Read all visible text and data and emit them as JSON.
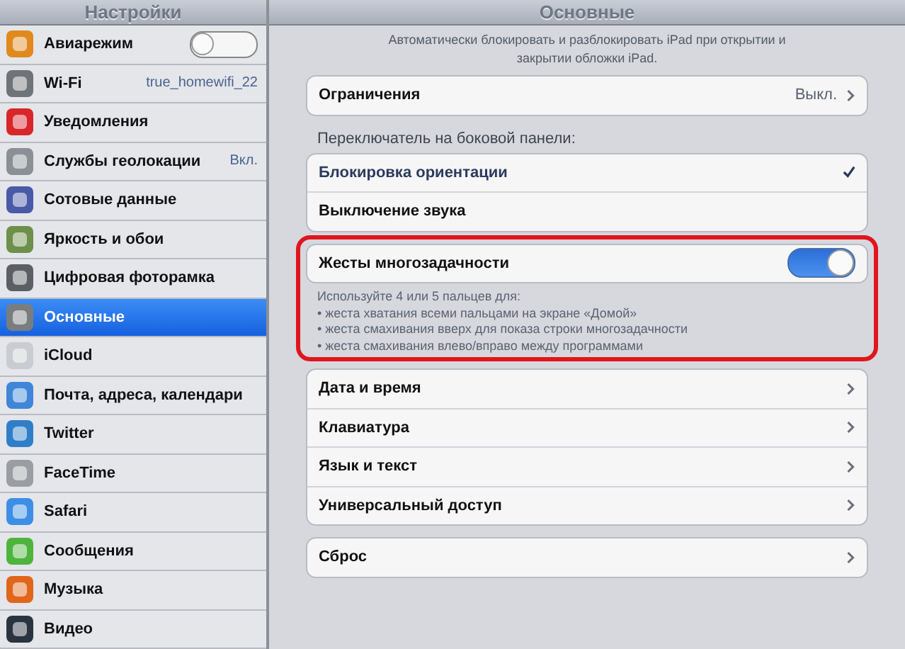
{
  "sidebar": {
    "title": "Настройки",
    "items": [
      {
        "label": "Авиарежим",
        "kind": "toggle",
        "on": false,
        "selected": false,
        "color": "#e08a1e"
      },
      {
        "label": "Wi-Fi",
        "kind": "value",
        "value": "true_homewifi_22",
        "selected": false,
        "color": "#6f7478"
      },
      {
        "label": "Уведомления",
        "kind": "plain",
        "selected": false,
        "color": "#d8262a"
      },
      {
        "label": "Службы геолокации",
        "kind": "value",
        "value": "Вкл.",
        "selected": false,
        "color": "#8a9096"
      },
      {
        "label": "Сотовые данные",
        "kind": "plain",
        "selected": false,
        "color": "#4a5aa8"
      },
      {
        "label": "Яркость и обои",
        "kind": "plain",
        "selected": false,
        "color": "#6d8f4a"
      },
      {
        "label": "Цифровая фоторамка",
        "kind": "plain",
        "selected": false,
        "color": "#5c5f63"
      },
      {
        "label": "Основные",
        "kind": "plain",
        "selected": true,
        "color": "#7a7d80"
      },
      {
        "label": "iCloud",
        "kind": "plain",
        "selected": false,
        "color": "#c9ccd0"
      },
      {
        "label": "Почта, адреса, календари",
        "kind": "plain",
        "selected": false,
        "color": "#3f86d8"
      },
      {
        "label": "Twitter",
        "kind": "plain",
        "selected": false,
        "color": "#2f7fc8"
      },
      {
        "label": "FaceTime",
        "kind": "plain",
        "selected": false,
        "color": "#9a9da2"
      },
      {
        "label": "Safari",
        "kind": "plain",
        "selected": false,
        "color": "#3d8ee6"
      },
      {
        "label": "Сообщения",
        "kind": "plain",
        "selected": false,
        "color": "#4fb43c"
      },
      {
        "label": "Музыка",
        "kind": "plain",
        "selected": false,
        "color": "#e0661c"
      },
      {
        "label": "Видео",
        "kind": "plain",
        "selected": false,
        "color": "#2a3440"
      }
    ]
  },
  "detail": {
    "title": "Основные",
    "description": "Автоматически блокировать и разблокировать iPad при открытии и закрытии обложки iPad.",
    "sections": [
      {
        "rows": [
          {
            "label": "Ограничения",
            "kind": "disclosure",
            "value": "Выкл."
          }
        ]
      },
      {
        "header": "Переключатель на боковой панели:",
        "rows": [
          {
            "label": "Блокировка ориентации",
            "kind": "check",
            "checked": true
          },
          {
            "label": "Выключение звука",
            "kind": "check",
            "checked": false
          }
        ]
      },
      {
        "highlighted": true,
        "rows": [
          {
            "label": "Жесты многозадачности",
            "kind": "toggle",
            "on": true
          }
        ],
        "footer": [
          "Используйте 4 или 5 пальцев для:",
          "• жеста хватания всеми пальцами на экране «Домой»",
          "• жеста смахивания вверх для показа строки многозадачности",
          "• жеста смахивания влево/вправо между программами"
        ]
      },
      {
        "rows": [
          {
            "label": "Дата и время",
            "kind": "disclosure"
          },
          {
            "label": "Клавиатура",
            "kind": "disclosure"
          },
          {
            "label": "Язык и текст",
            "kind": "disclosure"
          },
          {
            "label": "Универсальный доступ",
            "kind": "disclosure"
          }
        ]
      },
      {
        "rows": [
          {
            "label": "Сброс",
            "kind": "disclosure"
          }
        ]
      }
    ]
  }
}
